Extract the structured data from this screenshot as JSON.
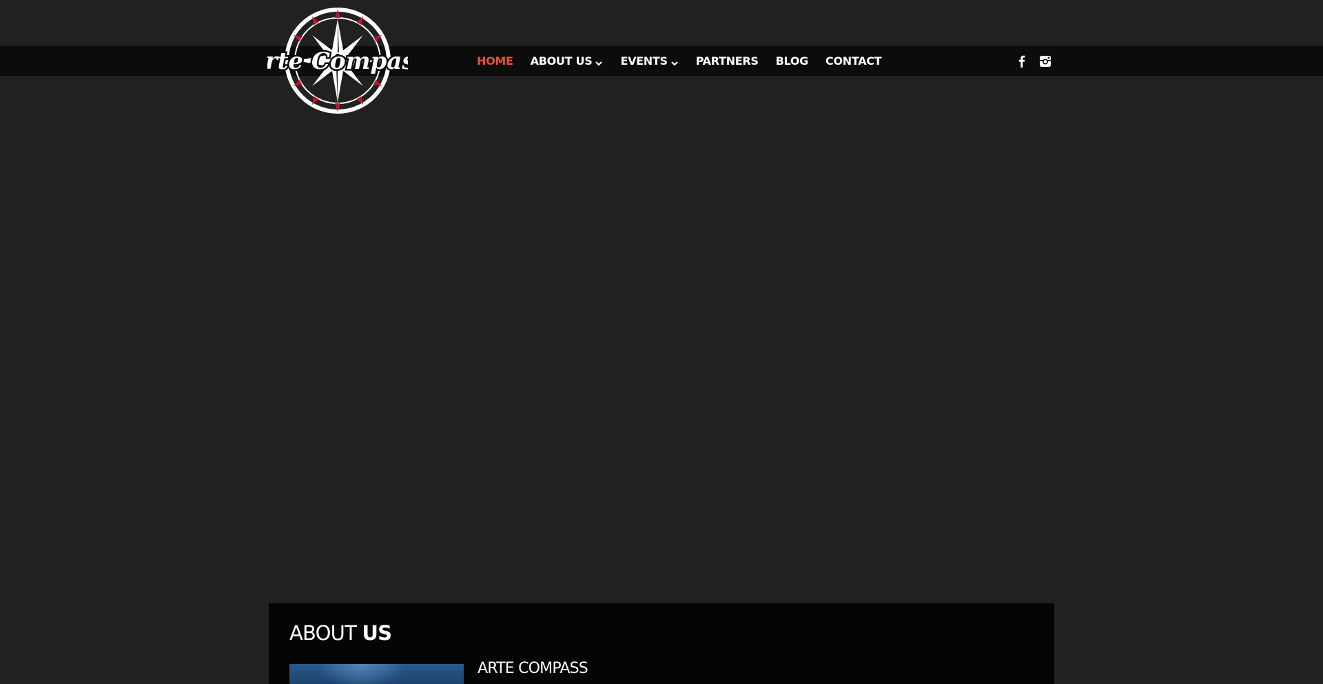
{
  "brand": {
    "logo_text": "Arte Compass"
  },
  "nav": {
    "items": [
      {
        "label": "HOME",
        "active": true,
        "has_dropdown": false
      },
      {
        "label": "ABOUT US",
        "active": false,
        "has_dropdown": true
      },
      {
        "label": "EVENTS",
        "active": false,
        "has_dropdown": true
      },
      {
        "label": "PARTNERS",
        "active": false,
        "has_dropdown": false
      },
      {
        "label": "BLOG",
        "active": false,
        "has_dropdown": false
      },
      {
        "label": "CONTACT",
        "active": false,
        "has_dropdown": false
      }
    ]
  },
  "social": {
    "icons": [
      "facebook-icon",
      "instagram-icon"
    ]
  },
  "about": {
    "title_light": "ABOUT",
    "title_bold": "US",
    "subtitle": "ARTE COMPASS"
  },
  "colors": {
    "page_background": "#212121",
    "navbar_background": "#0c0c0c",
    "active_link": "#e8523f",
    "link": "#ffffff",
    "about_background": "#050505",
    "compass_accent": "#c8102e"
  }
}
